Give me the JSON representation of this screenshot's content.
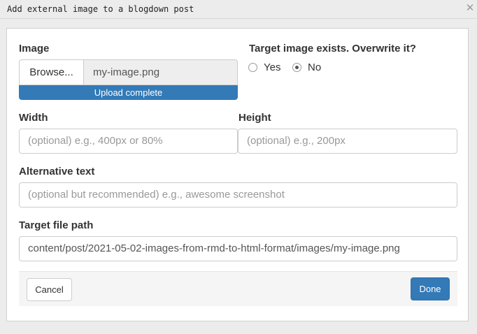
{
  "window": {
    "title": "Add external image to a blogdown post",
    "close_icon": "close-icon"
  },
  "image": {
    "label": "Image",
    "browse_label": "Browse...",
    "filename": "my-image.png",
    "upload_status": "Upload complete",
    "upload_progress": 1.0
  },
  "overwrite": {
    "label": "Target image exists. Overwrite it?",
    "options": [
      {
        "label": "Yes",
        "checked": false
      },
      {
        "label": "No",
        "checked": true
      }
    ]
  },
  "width": {
    "label": "Width",
    "value": "",
    "placeholder": "(optional) e.g., 400px or 80%"
  },
  "height": {
    "label": "Height",
    "value": "",
    "placeholder": "(optional) e.g., 200px"
  },
  "alt": {
    "label": "Alternative text",
    "value": "",
    "placeholder": "(optional but recommended) e.g., awesome screenshot"
  },
  "target": {
    "label": "Target file path",
    "value": "content/post/2021-05-02-images-from-rmd-to-html-format/images/my-image.png"
  },
  "footer": {
    "cancel_label": "Cancel",
    "done_label": "Done"
  },
  "colors": {
    "primary": "#337ab7",
    "window_bg": "#ececec"
  }
}
